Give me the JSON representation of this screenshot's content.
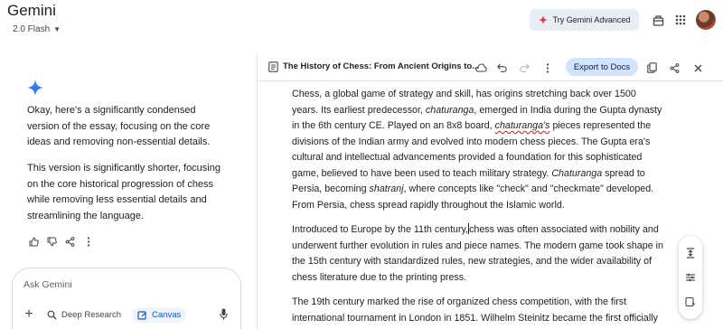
{
  "app": {
    "title": "Gemini",
    "model": "2.0 Flash"
  },
  "header": {
    "try_advanced_label": "Try Gemini Advanced"
  },
  "chat": {
    "messages": [
      "Okay, here's a significantly condensed version of the essay, focusing on the core ideas and removing non-essential details.",
      "This version is significantly shorter, focusing on the core historical progression of chess while removing less essential details and streamlining the language."
    ],
    "input_placeholder": "Ask Gemini",
    "tools": {
      "deep_research": "Deep Research",
      "canvas": "Canvas"
    }
  },
  "canvas": {
    "doc_title": "The History of Chess: From Ancient Origins to...",
    "export_label": "Export to Docs",
    "p1": {
      "a": "Chess, a global game of strategy and skill, has origins stretching back over 1500 years. Its earliest predecessor, ",
      "b": "chaturanga",
      "c": ", emerged in India during the Gupta dynasty in the 6th century CE. Played on an 8x8 board, ",
      "d": "chaturanga's",
      "e": " pieces represented the divisions of the Indian army and evolved into modern chess pieces. The Gupta era's cultural and intellectual advancements provided a foundation for this sophisticated game, believed to have been used to teach military strategy. ",
      "f": "Chaturanga",
      "g": " spread to Persia, becoming ",
      "h": "shatranj",
      "i": ", where concepts like \"check\" and \"checkmate\" developed. From Persia, chess spread rapidly throughout the Islamic world."
    },
    "p2": {
      "a": "Introduced to Europe by the 11th century,",
      "b": "chess was often associated with nobility and underwent further evolution in rules and piece names. The modern game took shape in the 15th century with standardized rules, new strategies, and the wider availability of chess literature due to the printing press."
    },
    "p3": "The 19th century marked the rise of organized chess competition, with the first international tournament in London in 1851. Wilhelm Steinitz became the first officially"
  },
  "colors": {
    "accent": "#0b57d0",
    "export_bg": "#d3e3fd",
    "chip_bg": "#e9eef6",
    "spark": "#4285f4"
  }
}
